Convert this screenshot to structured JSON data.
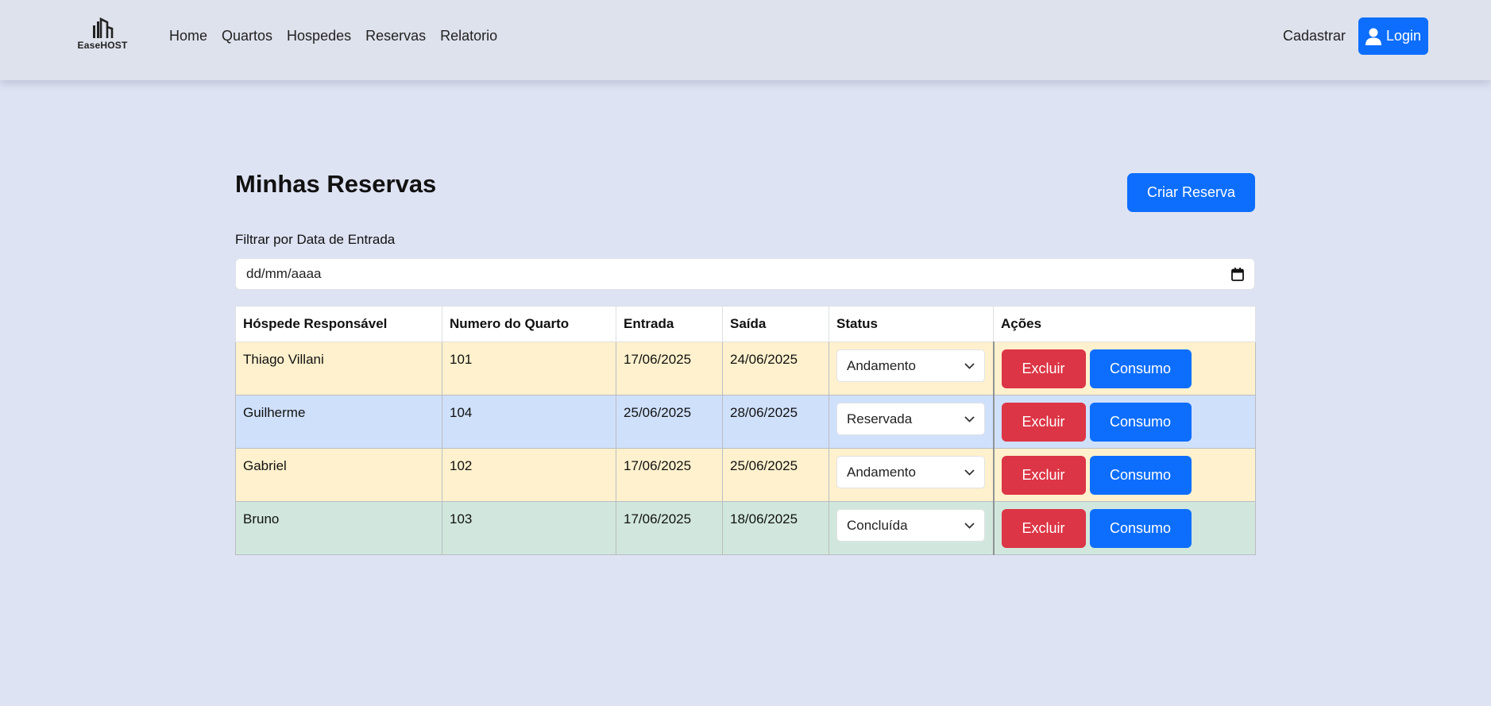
{
  "header": {
    "logo_text": "EaseHOST",
    "nav": [
      "Home",
      "Quartos",
      "Hospedes",
      "Reservas",
      "Relatorio"
    ],
    "cadastrar": "Cadastrar",
    "login": "Login"
  },
  "main": {
    "title": "Minhas Reservas",
    "create_button": "Criar Reserva",
    "filter_label": "Filtrar por Data de Entrada",
    "date_placeholder": "dd/mm/aaaa"
  },
  "table": {
    "headers": [
      "Hóspede Responsável",
      "Numero do Quarto",
      "Entrada",
      "Saída",
      "Status",
      "Ações"
    ],
    "rows": [
      {
        "guest": "Thiago Villani",
        "room": "101",
        "checkin": "17/06/2025",
        "checkout": "24/06/2025",
        "status": "Andamento",
        "excluir": "Excluir",
        "consumo": "Consumo"
      },
      {
        "guest": "Guilherme",
        "room": "104",
        "checkin": "25/06/2025",
        "checkout": "28/06/2025",
        "status": "Reservada",
        "excluir": "Excluir",
        "consumo": "Consumo"
      },
      {
        "guest": "Gabriel",
        "room": "102",
        "checkin": "17/06/2025",
        "checkout": "25/06/2025",
        "status": "Andamento",
        "excluir": "Excluir",
        "consumo": "Consumo"
      },
      {
        "guest": "Bruno",
        "room": "103",
        "checkin": "17/06/2025",
        "checkout": "18/06/2025",
        "status": "Concluída",
        "excluir": "Excluir",
        "consumo": "Consumo"
      }
    ]
  },
  "colors": {
    "primary": "#0d6efd",
    "danger": "#dc3545",
    "row_andamento": "#fff1cd",
    "row_reservada": "#cfe0fb",
    "row_concluida": "#d1e7dd",
    "background": "#dee3f3"
  },
  "icons": {
    "logo": "building-icon",
    "login": "user-icon",
    "date": "calendar-icon",
    "select": "chevron-down-icon"
  }
}
